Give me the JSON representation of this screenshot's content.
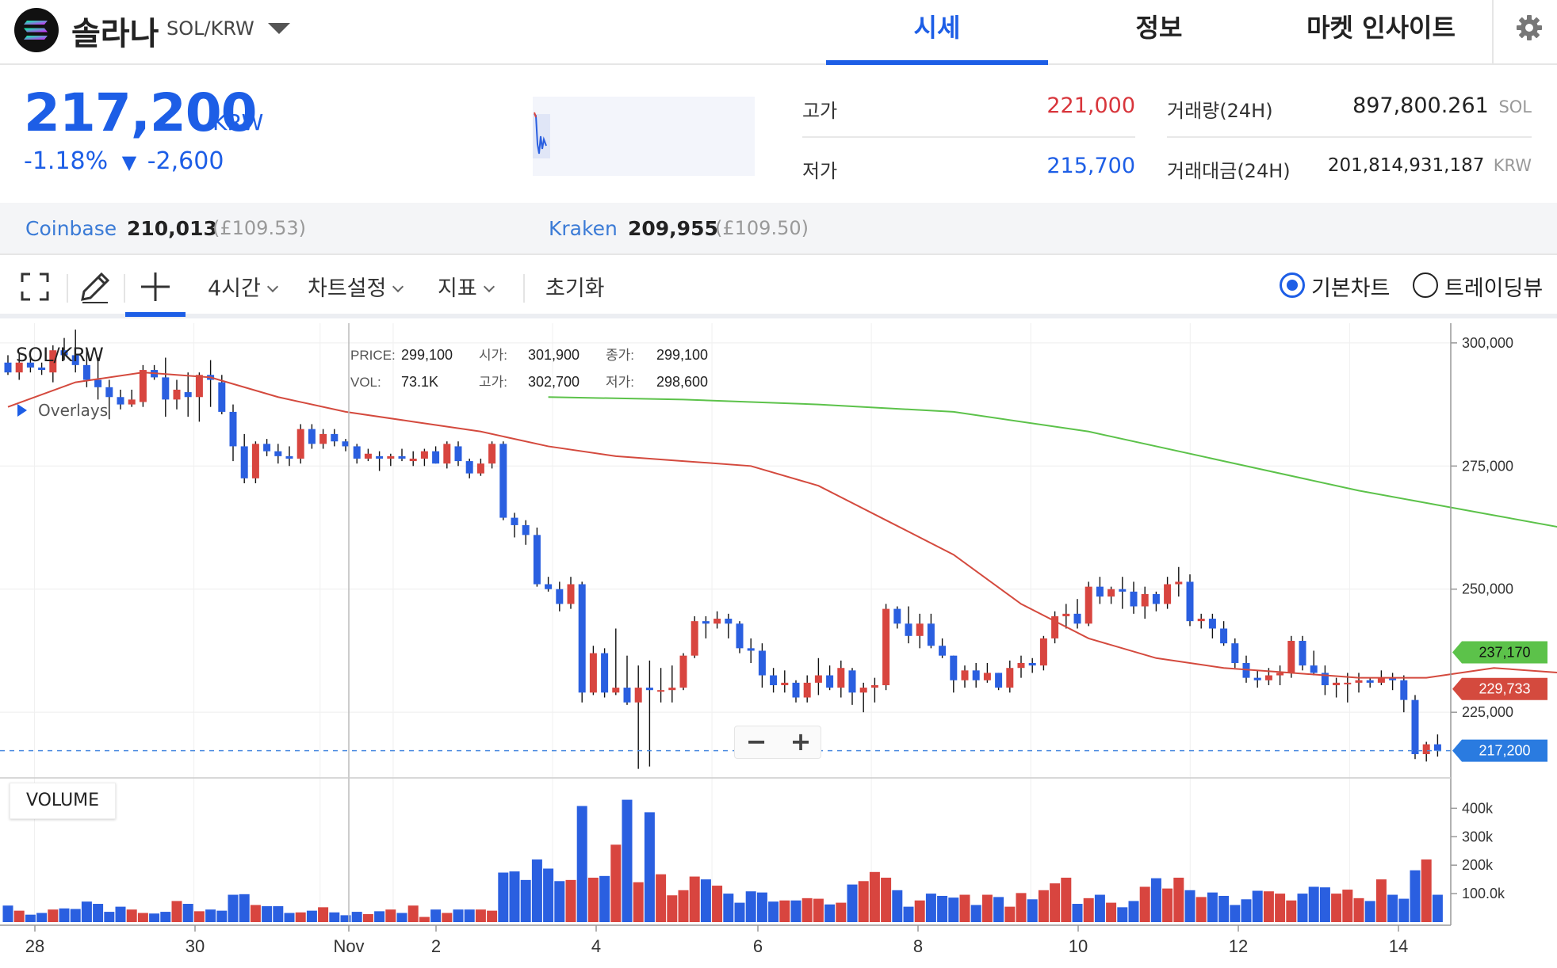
{
  "header": {
    "coin_name": "솔라나",
    "pair": "SOL/KRW",
    "tabs": [
      {
        "label": "시세",
        "active": true
      },
      {
        "label": "정보",
        "active": false
      },
      {
        "label": "마켓 인사이트",
        "active": false
      }
    ]
  },
  "price": {
    "current": "217,200",
    "unit": "KRW",
    "change_pct": "-1.18%",
    "change_arrow": "▼",
    "change_amount": "-2,600"
  },
  "stats": {
    "high_label": "고가",
    "high_value": "221,000",
    "low_label": "저가",
    "low_value": "215,700",
    "volume_label": "거래량(24H)",
    "volume_value": "897,800.261",
    "volume_unit": "SOL",
    "turnover_label": "거래대금(24H)",
    "turnover_value": "201,814,931,187",
    "turnover_unit": "KRW"
  },
  "exchanges": [
    {
      "name": "Coinbase",
      "price": "210,013",
      "gbp": "(£109.53)"
    },
    {
      "name": "Kraken",
      "price": "209,955",
      "gbp": "(£109.50)"
    }
  ],
  "toolbar": {
    "interval": "4시간",
    "chart_settings": "차트설정",
    "indicators": "지표",
    "reset": "초기화",
    "radio_basic": "기본차트",
    "radio_tradingview": "트레이딩뷰"
  },
  "colors": {
    "up": "#d8453f",
    "down": "#2a5fe0",
    "ma_short": "#d44a3e",
    "ma_long": "#5cc24a",
    "accent": "#1d5ee6"
  },
  "chart_data": {
    "type": "candlestick",
    "symbol": "SOL/KRW",
    "overlays_label": "Overlays",
    "volume_label": "VOLUME",
    "ohlc_legend": {
      "price_label": "PRICE:",
      "price": "299,100",
      "vol_label": "VOL:",
      "vol": "73.1K",
      "open_label": "시가:",
      "open": "301,900",
      "high_label": "고가:",
      "high": "302,700",
      "close_label": "종가:",
      "close": "299,100",
      "low_label": "저가:",
      "low": "298,600"
    },
    "y_ticks": [
      "300,000",
      "275,000",
      "250,000",
      "225,000"
    ],
    "y_tick_values": [
      300000,
      275000,
      250000,
      225000
    ],
    "ylim": [
      212000,
      304000
    ],
    "vol_ticks": [
      "400k",
      "300k",
      "200k",
      "100.0k"
    ],
    "vol_tick_values": [
      400000,
      300000,
      200000,
      100000
    ],
    "x_ticks": [
      "28",
      "30",
      "Nov",
      "2",
      "4",
      "6",
      "8",
      "10",
      "12",
      "14"
    ],
    "badges": {
      "ma_long": "237,170",
      "ma_short": "229,733",
      "price": "217,200"
    },
    "price_line": 217200,
    "candles": [
      [
        296000,
        297500,
        293500,
        294000
      ],
      [
        294000,
        298000,
        292500,
        296000
      ],
      [
        296000,
        297000,
        294000,
        295000
      ],
      [
        295000,
        296000,
        293500,
        294500
      ],
      [
        294000,
        299500,
        292000,
        298500
      ],
      [
        298500,
        301000,
        296500,
        297500
      ],
      [
        297500,
        302700,
        294000,
        295500
      ],
      [
        295500,
        298600,
        291000,
        292500
      ],
      [
        292500,
        297000,
        288500,
        291000
      ],
      [
        291000,
        292500,
        284500,
        289000
      ],
      [
        289000,
        290500,
        286500,
        287500
      ],
      [
        287500,
        290500,
        287000,
        288500
      ],
      [
        288000,
        295500,
        287000,
        294500
      ],
      [
        294500,
        295500,
        292500,
        293000
      ],
      [
        293000,
        297000,
        285000,
        288500
      ],
      [
        288500,
        292500,
        286500,
        290500
      ],
      [
        290000,
        294000,
        285000,
        289000
      ],
      [
        289000,
        294000,
        284000,
        293500
      ],
      [
        293500,
        296500,
        287000,
        292500
      ],
      [
        292000,
        293500,
        285500,
        286000
      ],
      [
        286000,
        287500,
        276000,
        279000
      ],
      [
        279000,
        281500,
        271500,
        272500
      ],
      [
        272500,
        280000,
        271500,
        279500
      ],
      [
        279500,
        280500,
        277000,
        278000
      ],
      [
        278000,
        279500,
        275500,
        277000
      ],
      [
        277000,
        279000,
        275000,
        276500
      ],
      [
        276500,
        283500,
        275500,
        282500
      ],
      [
        282500,
        283500,
        278500,
        279500
      ],
      [
        279500,
        282500,
        278500,
        281500
      ],
      [
        281500,
        282500,
        279000,
        280000
      ],
      [
        280000,
        280500,
        278000,
        279000
      ],
      [
        279000,
        279500,
        275500,
        276500
      ],
      [
        276500,
        278500,
        276000,
        277500
      ],
      [
        277000,
        278000,
        274000,
        276500
      ],
      [
        276500,
        277500,
        275000,
        277000
      ],
      [
        277000,
        278500,
        276000,
        276500
      ],
      [
        276000,
        278000,
        275000,
        276500
      ],
      [
        276500,
        278500,
        275000,
        278000
      ],
      [
        278000,
        279000,
        275500,
        275500
      ],
      [
        275500,
        280000,
        274500,
        279500
      ],
      [
        279000,
        280000,
        275000,
        276000
      ],
      [
        276000,
        276500,
        272500,
        273500
      ],
      [
        273500,
        276500,
        273000,
        275500
      ],
      [
        275500,
        280000,
        274500,
        279500
      ],
      [
        279500,
        280000,
        264000,
        264500
      ],
      [
        264500,
        265500,
        260500,
        263000
      ],
      [
        263000,
        264000,
        259000,
        261000
      ],
      [
        261000,
        262500,
        250500,
        251000
      ],
      [
        251000,
        252500,
        249500,
        250000
      ],
      [
        250000,
        251500,
        245500,
        247000
      ],
      [
        247000,
        252500,
        246000,
        251000
      ],
      [
        251000,
        251500,
        227000,
        229000
      ],
      [
        229000,
        238500,
        228500,
        237000
      ],
      [
        237000,
        238000,
        228000,
        229000
      ],
      [
        229000,
        242000,
        228500,
        230000
      ],
      [
        230000,
        236500,
        226500,
        227000
      ],
      [
        227000,
        234500,
        213500,
        230000
      ],
      [
        230000,
        235500,
        214000,
        229500
      ],
      [
        229500,
        234000,
        227000,
        229500
      ],
      [
        229500,
        234500,
        227000,
        230000
      ],
      [
        230000,
        237000,
        229500,
        236500
      ],
      [
        236500,
        244500,
        236000,
        243500
      ],
      [
        243500,
        244500,
        240000,
        243000
      ],
      [
        243000,
        245500,
        242000,
        244000
      ],
      [
        244000,
        245000,
        240000,
        243000
      ],
      [
        243000,
        243500,
        237000,
        238000
      ],
      [
        238000,
        240000,
        235000,
        237500
      ],
      [
        237500,
        239000,
        230000,
        232500
      ],
      [
        232500,
        234000,
        229000,
        230500
      ],
      [
        230500,
        233500,
        229000,
        231000
      ],
      [
        231000,
        231500,
        227000,
        228000
      ],
      [
        228000,
        232500,
        227000,
        231000
      ],
      [
        231000,
        236000,
        228500,
        232500
      ],
      [
        232500,
        234500,
        229500,
        230000
      ],
      [
        230000,
        235500,
        228000,
        234000
      ],
      [
        233500,
        234000,
        226500,
        229000
      ],
      [
        229000,
        231000,
        225000,
        230000
      ],
      [
        230000,
        232000,
        227000,
        230500
      ],
      [
        230500,
        247000,
        229500,
        246000
      ],
      [
        246000,
        246500,
        242000,
        243000
      ],
      [
        243000,
        246500,
        239000,
        240500
      ],
      [
        240500,
        245000,
        238000,
        243000
      ],
      [
        243000,
        245000,
        238000,
        238500
      ],
      [
        238500,
        240000,
        236000,
        236500
      ],
      [
        236500,
        236500,
        229000,
        231500
      ],
      [
        231500,
        234500,
        230000,
        233500
      ],
      [
        233500,
        235000,
        230000,
        231500
      ],
      [
        231500,
        235000,
        231000,
        233000
      ],
      [
        233000,
        233000,
        229500,
        230000
      ],
      [
        230000,
        235500,
        229000,
        234000
      ],
      [
        234000,
        236500,
        232000,
        235000
      ],
      [
        235000,
        236000,
        233000,
        234500
      ],
      [
        234500,
        240500,
        233500,
        240000
      ],
      [
        240000,
        245500,
        239000,
        244500
      ],
      [
        244500,
        247000,
        242000,
        245000
      ],
      [
        245000,
        248000,
        242000,
        243000
      ],
      [
        243000,
        251500,
        242500,
        250500
      ],
      [
        250500,
        252500,
        247000,
        248500
      ],
      [
        248500,
        250500,
        247000,
        250000
      ],
      [
        250000,
        252500,
        246000,
        249500
      ],
      [
        249500,
        251500,
        245000,
        246500
      ],
      [
        246500,
        250500,
        244000,
        249000
      ],
      [
        249000,
        249500,
        245500,
        247000
      ],
      [
        247000,
        252500,
        246000,
        251000
      ],
      [
        251000,
        254500,
        248500,
        251500
      ],
      [
        251500,
        253000,
        242500,
        243500
      ],
      [
        243500,
        245000,
        242000,
        244000
      ],
      [
        244000,
        245000,
        240000,
        242000
      ],
      [
        242000,
        243500,
        238500,
        239000
      ],
      [
        239000,
        240000,
        234000,
        235000
      ],
      [
        235000,
        236500,
        231000,
        232000
      ],
      [
        232000,
        233500,
        230000,
        231500
      ],
      [
        231500,
        234000,
        230500,
        232500
      ],
      [
        232500,
        234500,
        230500,
        233000
      ],
      [
        233000,
        240500,
        232000,
        239500
      ],
      [
        239500,
        240500,
        233500,
        234500
      ],
      [
        234500,
        237500,
        232500,
        233000
      ],
      [
        233000,
        234500,
        228500,
        230500
      ],
      [
        230500,
        232000,
        228000,
        231000
      ],
      [
        231000,
        233000,
        227000,
        231000
      ],
      [
        231000,
        233000,
        229000,
        231500
      ],
      [
        231500,
        232000,
        230000,
        231000
      ],
      [
        231000,
        233500,
        230500,
        232000
      ],
      [
        232000,
        233000,
        229500,
        231500
      ],
      [
        231500,
        232500,
        225000,
        227500
      ],
      [
        227500,
        228500,
        215500,
        216500
      ],
      [
        216500,
        219000,
        215000,
        218500
      ],
      [
        218500,
        220500,
        216000,
        217200
      ]
    ],
    "volumes": [
      58,
      40,
      26,
      32,
      44,
      48,
      46,
      72,
      64,
      36,
      54,
      44,
      32,
      30,
      36,
      74,
      64,
      38,
      44,
      40,
      96,
      98,
      60,
      56,
      56,
      32,
      34,
      40,
      52,
      34,
      24,
      36,
      28,
      38,
      44,
      32,
      58,
      18,
      44,
      32,
      44,
      44,
      44,
      40,
      174,
      178,
      148,
      220,
      188,
      144,
      148,
      408,
      156,
      162,
      272,
      430,
      140,
      386,
      168,
      94,
      112,
      160,
      150,
      128,
      100,
      68,
      108,
      104,
      72,
      76,
      76,
      84,
      82,
      62,
      68,
      132,
      144,
      176,
      156,
      112,
      54,
      76,
      100,
      92,
      86,
      96,
      60,
      96,
      88,
      54,
      102,
      80,
      112,
      136,
      156,
      64,
      84,
      96,
      68,
      52,
      74,
      124,
      154,
      118,
      156,
      112,
      88,
      104,
      92,
      60,
      80,
      110,
      108,
      100,
      76,
      100,
      124,
      122,
      100,
      114,
      84,
      74,
      150,
      96,
      82,
      182,
      220,
      96
    ],
    "ma_short": [
      [
        0,
        287000
      ],
      [
        6,
        292000
      ],
      [
        12,
        294000
      ],
      [
        18,
        293000
      ],
      [
        24,
        289000
      ],
      [
        30,
        286000
      ],
      [
        36,
        284000
      ],
      [
        42,
        282000
      ],
      [
        48,
        279000
      ],
      [
        54,
        277000
      ],
      [
        60,
        276000
      ],
      [
        66,
        275000
      ],
      [
        72,
        271000
      ],
      [
        78,
        264000
      ],
      [
        84,
        257000
      ],
      [
        90,
        247000
      ],
      [
        96,
        240000
      ],
      [
        102,
        236000
      ],
      [
        108,
        234000
      ],
      [
        114,
        233000
      ],
      [
        120,
        232000
      ],
      [
        126,
        232000
      ],
      [
        132,
        234000
      ],
      [
        138,
        233000
      ],
      [
        144,
        232500
      ],
      [
        150,
        233000
      ],
      [
        156,
        238000
      ],
      [
        162,
        242000
      ],
      [
        168,
        244000
      ],
      [
        174,
        245000
      ],
      [
        180,
        243000
      ],
      [
        186,
        240000
      ],
      [
        192,
        238000
      ],
      [
        198,
        235000
      ],
      [
        204,
        232000
      ],
      [
        210,
        229733
      ]
    ],
    "ma_long": [
      [
        48,
        289000
      ],
      [
        60,
        288500
      ],
      [
        72,
        287500
      ],
      [
        84,
        286000
      ],
      [
        96,
        282000
      ],
      [
        108,
        276000
      ],
      [
        120,
        270000
      ],
      [
        132,
        265000
      ],
      [
        144,
        260000
      ],
      [
        156,
        257000
      ],
      [
        168,
        253000
      ],
      [
        180,
        249500
      ],
      [
        192,
        246500
      ],
      [
        204,
        243500
      ],
      [
        216,
        240500
      ],
      [
        228,
        238800
      ],
      [
        240,
        237800
      ],
      [
        252,
        237170
      ]
    ]
  }
}
